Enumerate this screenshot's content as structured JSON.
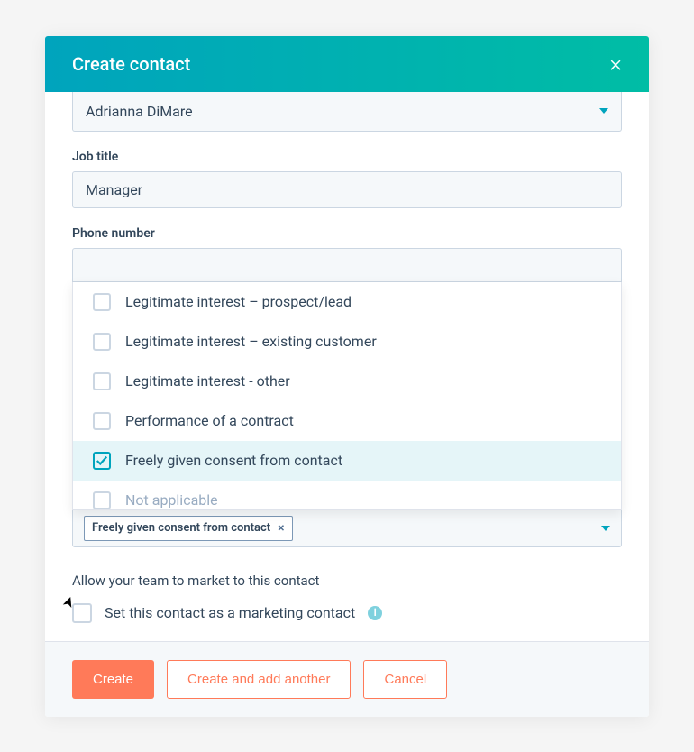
{
  "header": {
    "title": "Create contact",
    "close_label": "×"
  },
  "fields": {
    "owner_value": "Adrianna DiMare",
    "job_title_label": "Job title",
    "job_title_value": "Manager",
    "phone_label": "Phone number"
  },
  "options": [
    {
      "label": "Legitimate interest – prospect/lead",
      "checked": false
    },
    {
      "label": "Legitimate interest – existing customer",
      "checked": false
    },
    {
      "label": "Legitimate interest - other",
      "checked": false
    },
    {
      "label": "Performance of a contract",
      "checked": false
    },
    {
      "label": "Freely given consent from contact",
      "checked": true
    },
    {
      "label": "Not applicable",
      "checked": false
    }
  ],
  "selected_tag": {
    "label": "Freely given consent from contact",
    "remove": "×"
  },
  "marketing": {
    "section_title": "Allow your team to market to this contact",
    "checkbox_label": "Set this contact as a marketing contact",
    "info": "i"
  },
  "footer": {
    "create": "Create",
    "create_another": "Create and add another",
    "cancel": "Cancel"
  }
}
